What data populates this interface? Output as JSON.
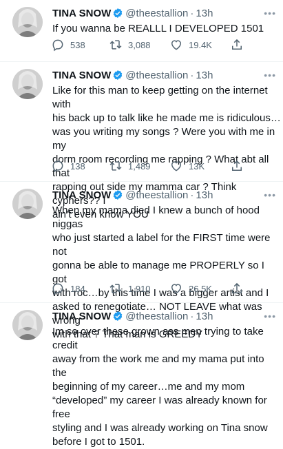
{
  "tweets": [
    {
      "name": "TINA SNOW",
      "handle": "@theestallion",
      "sep": "·",
      "time": "13h",
      "text": "If you wanna be REALLL I DEVELOPED 1501",
      "replies": "538",
      "retweets": "3,088",
      "likes": "19.4K"
    },
    {
      "name": "TINA SNOW",
      "handle": "@theestallion",
      "sep": "·",
      "time": "13h",
      "text": "Like for this man to keep getting on the internet with\nhis back up to talk like he made me is ridiculous…\nwas you writing my songs ? Were you with me in my\ndorm room recording me rapping ? What abt all that\nrapping out side my mamma car ? Think cyphers?? I\nain’t even know YOU",
      "replies": "138",
      "retweets": "1,489",
      "likes": "13K"
    },
    {
      "name": "TINA SNOW",
      "handle": "@theestallion",
      "sep": "·",
      "time": "13h",
      "text": "When my mama died I knew a bunch of hood niggas\nwho just started a label for the FIRST time were not\ngonna be able to manage me PROPERLY so I got\nwith roc…by this time I was a bigger artist and I\nasked to renegotiate… NOT LEAVE what was wrong\nwith that ? That man is GREEDY",
      "replies": "184",
      "retweets": "1,910",
      "likes": "26.5K"
    },
    {
      "name": "TINA SNOW",
      "handle": "@theestallion",
      "sep": "·",
      "time": "13h",
      "text": "Im so over these grown ass men trying to take credit\naway from the work me and my mama put into the\nbeginning of my career…me and my mom\n“developed” my career I was already known for free\nstyling and I was already working on Tina snow\nbefore I got to 1501.",
      "replies": "",
      "retweets": "",
      "likes": ""
    }
  ],
  "icons": {
    "reply": "reply-icon",
    "retweet": "retweet-icon",
    "like": "like-icon",
    "share": "share-icon",
    "verified": "verified-badge-icon",
    "more": "more-icon"
  },
  "colors": {
    "verified": "#1d9bf0",
    "secondary_text": "#536471",
    "divider": "#eff3f4"
  }
}
